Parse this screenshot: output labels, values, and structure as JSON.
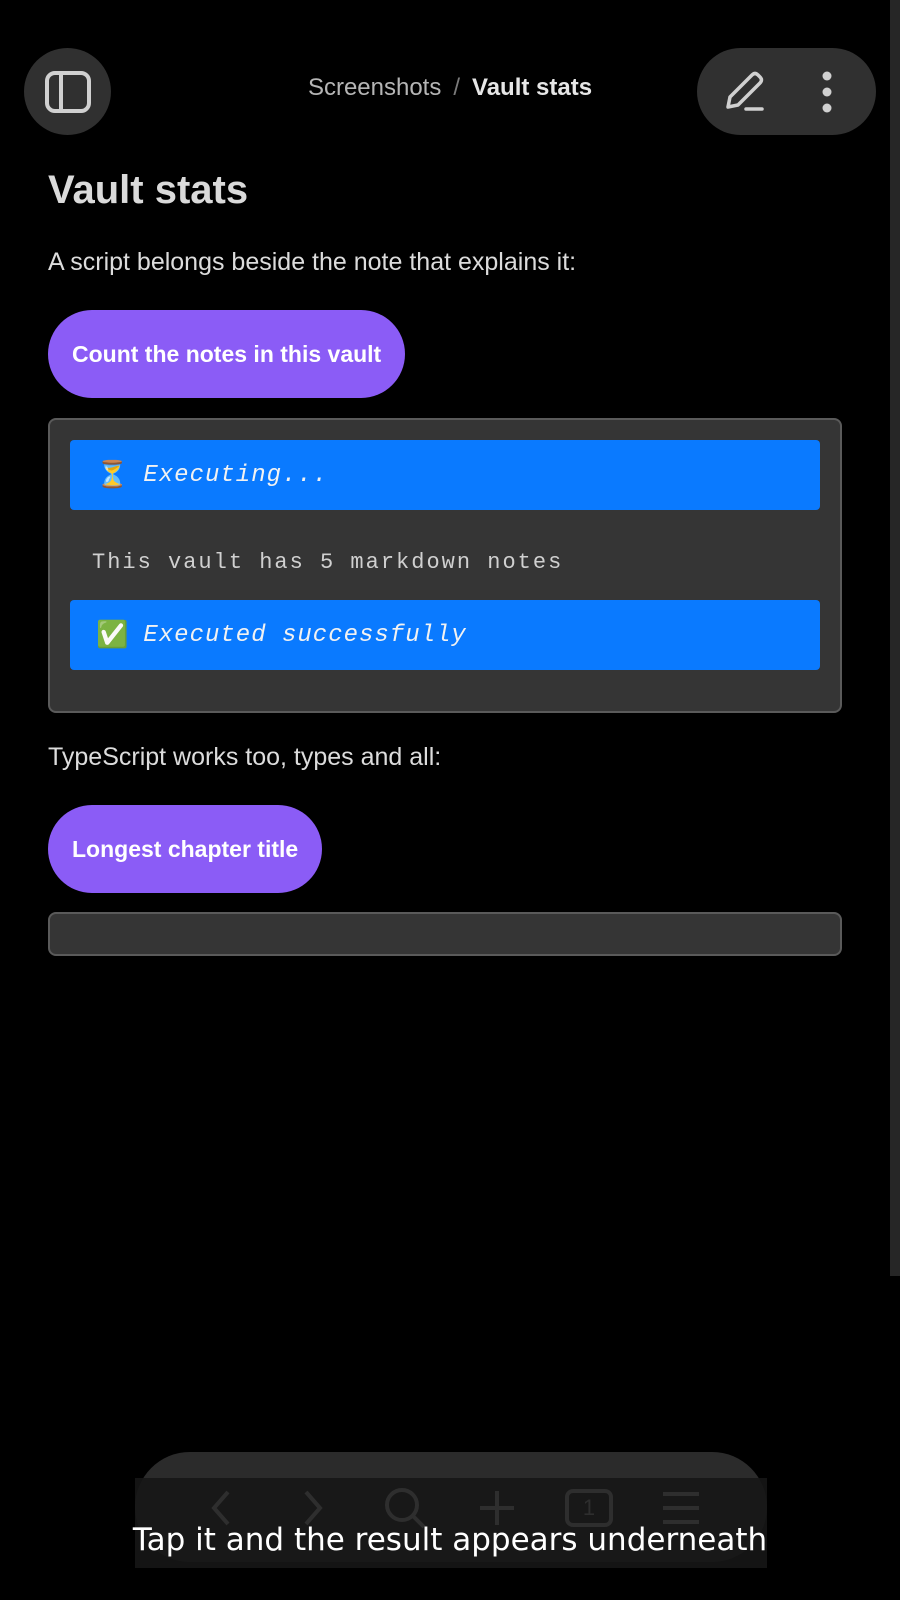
{
  "header": {
    "sidebar_toggle_icon": "sidebar-toggle-icon",
    "breadcrumb_parent": "Screenshots",
    "breadcrumb_separator": "/",
    "breadcrumb_current": "Vault stats",
    "edit_icon": "pencil-icon",
    "more_icon": "vertical-ellipsis-icon"
  },
  "note": {
    "title": "Vault stats",
    "para1": "A script belongs beside the note that explains it:",
    "button1_label": "Count the notes in this vault",
    "output1": {
      "executing_icon": "⏳",
      "executing_text": "Executing...",
      "result_line": "This vault has 5 markdown notes",
      "success_icon": "✅",
      "success_text": "Executed successfully"
    },
    "para2": "TypeScript works too, types and all:",
    "button2_label": "Longest chapter title"
  },
  "bottom_toolbar": {
    "icons": [
      "back-icon",
      "forward-icon",
      "search-icon",
      "plus-icon",
      "tabs-icon",
      "menu-icon"
    ],
    "tab_count": "1"
  },
  "caption": "Tap it and the result appears underneath",
  "colors": {
    "background": "#000000",
    "button_purple": "#8b5cf6",
    "status_blue": "#0a7aff",
    "panel": "#353535"
  }
}
